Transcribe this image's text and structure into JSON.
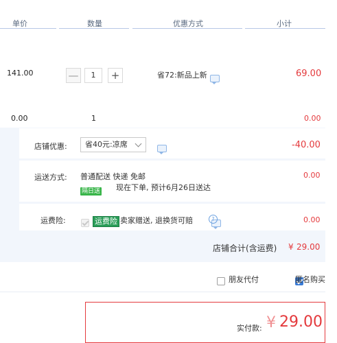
{
  "header": {
    "col_price": "单价",
    "col_qty": "数量",
    "col_promo": "优惠方式",
    "col_subtotal": "小计"
  },
  "item1": {
    "price": "141.00",
    "qty": "1",
    "qty_minus": "—",
    "qty_plus": "+",
    "promo": "省72:新品上新",
    "subtotal": "69.00"
  },
  "item2": {
    "price": "0.00",
    "qty": "1",
    "subtotal": "0.00"
  },
  "shop_discount": {
    "label": "店铺优惠:",
    "selected": "省40元:凉席",
    "amount": "-40.00"
  },
  "shipping": {
    "label": "运送方式:",
    "method": "普通配送 快递 免邮",
    "badge": "隔日送",
    "eta": "现在下单, 预计6月26日送达",
    "amount": "0.00"
  },
  "insurance": {
    "label": "运费险:",
    "badge": "运费险",
    "desc": "卖家赠送, 退换货可赔",
    "amount": "0.00"
  },
  "shop_total": {
    "label": "店铺合计(含运费)",
    "currency": "¥",
    "amount": "29.00"
  },
  "options": {
    "friend_pay": "朋友代付",
    "anonymous": "匿名购买"
  },
  "payment": {
    "label": "实付款:",
    "currency": "¥",
    "amount": "29.00"
  },
  "colors": {
    "accent_red": "#e4393c",
    "panel_bg": "#f2f6fc",
    "checkbox_blue": "#3a7bd5",
    "badge_green": "#2a9d58"
  }
}
